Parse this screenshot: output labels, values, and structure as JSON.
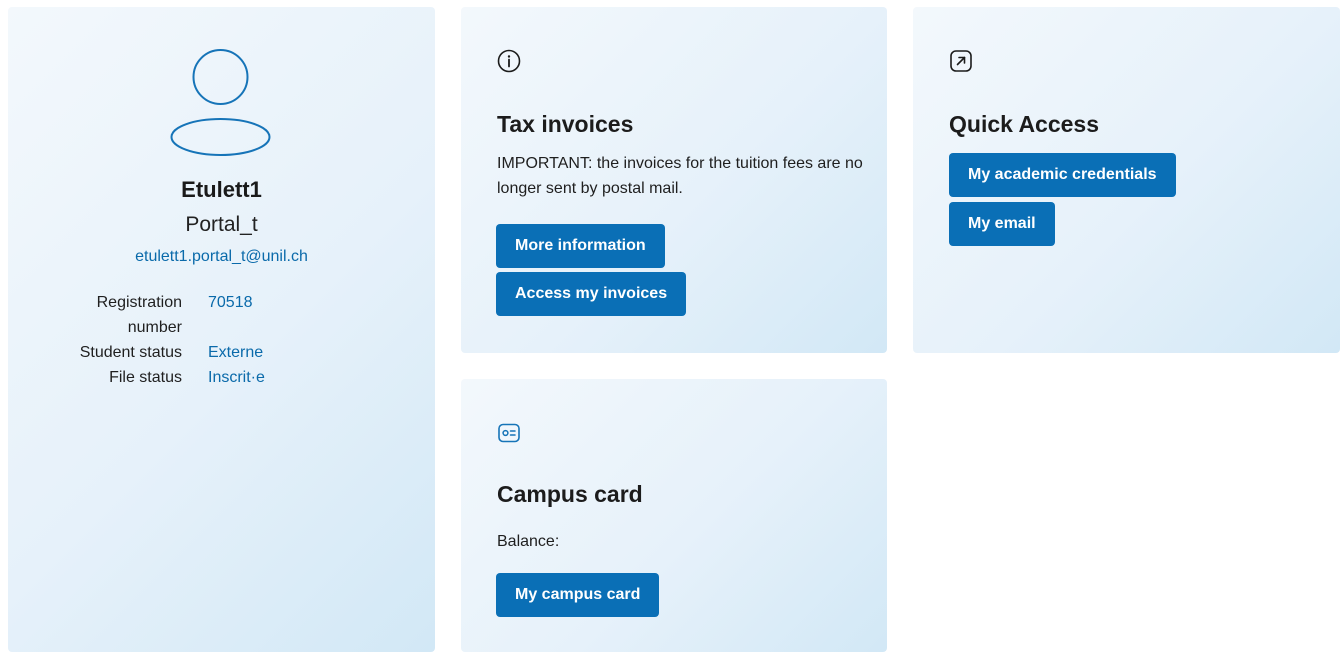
{
  "profile": {
    "avatar_icon": "user-icon",
    "name": "Etulett1",
    "subname": "Portal_t",
    "email": "etulett1.portal_t@unil.ch",
    "fields": [
      {
        "label": "Registration number",
        "value": "70518"
      },
      {
        "label": "Student status",
        "value": "Externe"
      },
      {
        "label": "File status",
        "value": "Inscrit·e"
      }
    ]
  },
  "tax_invoices": {
    "icon": "info-icon",
    "title": "Tax invoices",
    "text": "IMPORTANT: the invoices for the tuition fees are no longer sent by postal mail.",
    "buttons": {
      "more_info": "More information",
      "access_invoices": "Access my invoices"
    }
  },
  "quick_access": {
    "icon": "external-link-icon",
    "title": "Quick Access",
    "buttons": {
      "credentials": "My academic credentials",
      "email": "My email"
    }
  },
  "campus_card": {
    "icon": "id-card-icon",
    "title": "Campus card",
    "balance_label": "Balance:",
    "button": "My campus card"
  },
  "colors": {
    "accent": "#0a6fb6",
    "link": "#0a6aaa",
    "card_bg_start": "#f3f8fc",
    "card_bg_end": "#d2e8f6"
  }
}
